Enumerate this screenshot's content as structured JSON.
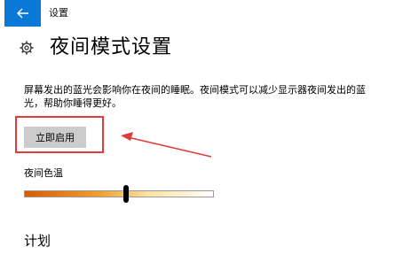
{
  "header": {
    "back_icon": "arrow-left-icon",
    "app_title": "设置"
  },
  "main": {
    "title_icon": "gear-icon",
    "title": "夜间模式设置",
    "description": "屏幕发出的蓝光会影响你在夜间的睡眠。夜间模式可以减少显示器夜间发出的蓝光，帮助你睡得更好。",
    "enable_now_label": "立即启用",
    "color_temp_label": "夜间色温",
    "color_temp_value": 0.54,
    "schedule_heading": "计划"
  },
  "colors": {
    "accent": "#0a78d7",
    "annotation": "#e03c3c",
    "slider_warm": "#d95a00",
    "button_bg": "#cccccc"
  }
}
